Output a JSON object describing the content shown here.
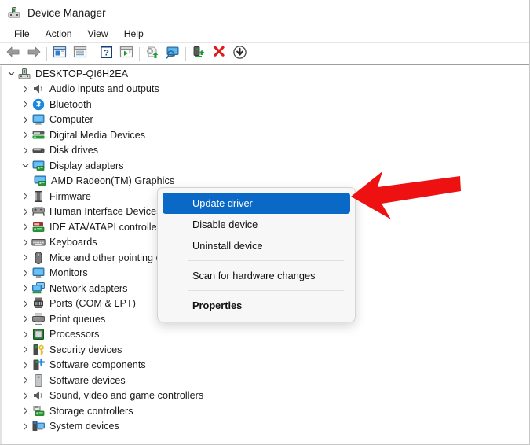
{
  "window": {
    "title": "Device Manager",
    "icon": "device-manager-icon"
  },
  "menubar": {
    "items": [
      {
        "label": "File"
      },
      {
        "label": "Action"
      },
      {
        "label": "View"
      },
      {
        "label": "Help"
      }
    ]
  },
  "toolbar": {
    "buttons": [
      {
        "icon": "back-arrow-icon",
        "label": "Back"
      },
      {
        "icon": "forward-arrow-icon",
        "label": "Forward"
      },
      {
        "icon": "separator",
        "label": ""
      },
      {
        "icon": "properties-icon",
        "label": "Properties"
      },
      {
        "icon": "show-hidden-devices-icon",
        "label": "Show hidden devices"
      },
      {
        "icon": "separator",
        "label": ""
      },
      {
        "icon": "help-icon",
        "label": "Help"
      },
      {
        "icon": "enable-device-icon",
        "label": "Enable device"
      },
      {
        "icon": "separator",
        "label": ""
      },
      {
        "icon": "update-driver-icon",
        "label": "Update driver"
      },
      {
        "icon": "scan-hardware-icon",
        "label": "Scan for hardware changes"
      },
      {
        "icon": "separator",
        "label": ""
      },
      {
        "icon": "install-legacy-hardware-icon",
        "label": "Add legacy hardware"
      },
      {
        "icon": "uninstall-device-icon",
        "label": "Uninstall device"
      },
      {
        "icon": "disable-device-icon",
        "label": "Disable device"
      }
    ]
  },
  "tree": {
    "nodes": [
      {
        "label": "DESKTOP-QI6H2EA",
        "depth": 0,
        "state": "expanded",
        "icon": "computer-root-icon",
        "selected": false
      },
      {
        "label": "Audio inputs and outputs",
        "depth": 1,
        "state": "collapsed",
        "icon": "speaker-icon",
        "selected": false
      },
      {
        "label": "Bluetooth",
        "depth": 1,
        "state": "collapsed",
        "icon": "bluetooth-icon",
        "selected": false
      },
      {
        "label": "Computer",
        "depth": 1,
        "state": "collapsed",
        "icon": "monitor-icon",
        "selected": false
      },
      {
        "label": "Digital Media Devices",
        "depth": 1,
        "state": "collapsed",
        "icon": "media-device-icon",
        "selected": false
      },
      {
        "label": "Disk drives",
        "depth": 1,
        "state": "collapsed",
        "icon": "disk-drive-icon",
        "selected": false
      },
      {
        "label": "Display adapters",
        "depth": 1,
        "state": "expanded",
        "icon": "display-adapter-icon",
        "selected": false
      },
      {
        "label": "AMD Radeon(TM) Graphics",
        "depth": 2,
        "state": "leaf",
        "icon": "display-adapter-icon",
        "selected": true
      },
      {
        "label": "Firmware",
        "depth": 1,
        "state": "collapsed",
        "icon": "firmware-icon",
        "selected": false
      },
      {
        "label": "Human Interface Devices",
        "depth": 1,
        "state": "collapsed",
        "icon": "hid-icon",
        "selected": false
      },
      {
        "label": "IDE ATA/ATAPI controllers",
        "depth": 1,
        "state": "collapsed",
        "icon": "ide-controller-icon",
        "selected": false
      },
      {
        "label": "Keyboards",
        "depth": 1,
        "state": "collapsed",
        "icon": "keyboard-icon",
        "selected": false
      },
      {
        "label": "Mice and other pointing devices",
        "depth": 1,
        "state": "collapsed",
        "icon": "mouse-icon",
        "selected": false
      },
      {
        "label": "Monitors",
        "depth": 1,
        "state": "collapsed",
        "icon": "monitor-icon",
        "selected": false
      },
      {
        "label": "Network adapters",
        "depth": 1,
        "state": "collapsed",
        "icon": "network-adapter-icon",
        "selected": false
      },
      {
        "label": "Ports (COM & LPT)",
        "depth": 1,
        "state": "collapsed",
        "icon": "port-icon",
        "selected": false
      },
      {
        "label": "Print queues",
        "depth": 1,
        "state": "collapsed",
        "icon": "printer-icon",
        "selected": false
      },
      {
        "label": "Processors",
        "depth": 1,
        "state": "collapsed",
        "icon": "processor-icon",
        "selected": false
      },
      {
        "label": "Security devices",
        "depth": 1,
        "state": "collapsed",
        "icon": "security-device-icon",
        "selected": false
      },
      {
        "label": "Software components",
        "depth": 1,
        "state": "collapsed",
        "icon": "software-component-icon",
        "selected": false
      },
      {
        "label": "Software devices",
        "depth": 1,
        "state": "collapsed",
        "icon": "software-device-icon",
        "selected": false
      },
      {
        "label": "Sound, video and game controllers",
        "depth": 1,
        "state": "collapsed",
        "icon": "speaker-icon",
        "selected": false
      },
      {
        "label": "Storage controllers",
        "depth": 1,
        "state": "collapsed",
        "icon": "storage-controller-icon",
        "selected": false
      },
      {
        "label": "System devices",
        "depth": 1,
        "state": "collapsed",
        "icon": "system-device-icon",
        "selected": false
      }
    ]
  },
  "context_menu": {
    "items": [
      {
        "label": "Update driver",
        "type": "item",
        "highlighted": true,
        "bold": false
      },
      {
        "label": "Disable device",
        "type": "item",
        "highlighted": false,
        "bold": false
      },
      {
        "label": "Uninstall device",
        "type": "item",
        "highlighted": false,
        "bold": false
      },
      {
        "label": "",
        "type": "separator",
        "highlighted": false,
        "bold": false
      },
      {
        "label": "Scan for hardware changes",
        "type": "item",
        "highlighted": false,
        "bold": false
      },
      {
        "label": "",
        "type": "separator",
        "highlighted": false,
        "bold": false
      },
      {
        "label": "Properties",
        "type": "item",
        "highlighted": false,
        "bold": true
      }
    ]
  },
  "annotation": {
    "arrow": "red-left-arrow",
    "points_at": "Update driver"
  },
  "colors": {
    "selection_blue": "#0a69c7",
    "tree_selection": "#cce4f7",
    "annotation_red": "#ee1111",
    "window_bg": "#ffffff",
    "menu_bg": "#f7f7f7"
  }
}
